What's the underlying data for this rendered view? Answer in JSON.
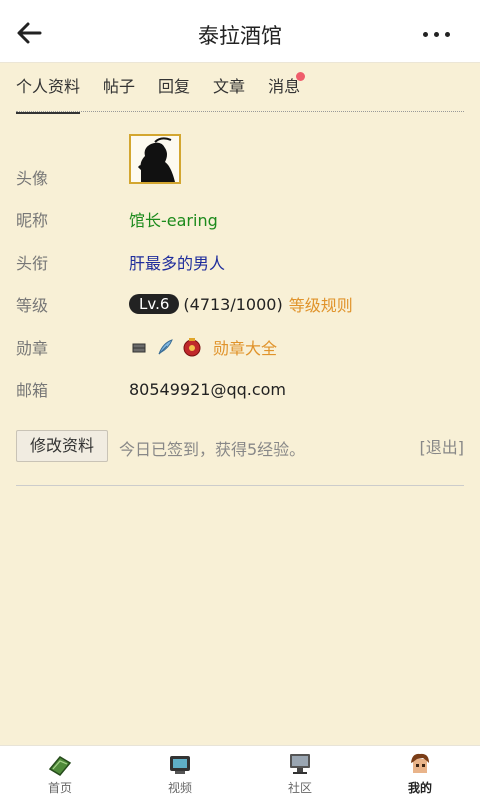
{
  "header": {
    "title": "泰拉酒馆"
  },
  "tabs": [
    {
      "label": "个人资料",
      "active": true
    },
    {
      "label": "帖子"
    },
    {
      "label": "回复"
    },
    {
      "label": "文章"
    },
    {
      "label": "消息",
      "has_dot": true
    }
  ],
  "profile": {
    "avatar_label": "头像",
    "nickname_label": "昵称",
    "nickname": "馆长-earing",
    "title_label": "头衔",
    "title": "肝最多的男人",
    "level_label": "等级",
    "level_badge": "Lv.6",
    "level_progress": "(4713/1000)",
    "level_rules": "等级规则",
    "medal_label": "勋章",
    "medal_link": "勋章大全",
    "email_label": "邮箱",
    "email": "80549921@qq.com"
  },
  "actions": {
    "edit_button": "修改资料",
    "signin_text": "今日已签到，获得5经验。",
    "logout": "[退出]"
  },
  "bottom_nav": [
    {
      "label": "首页",
      "icon": "home-book-icon"
    },
    {
      "label": "视频",
      "icon": "tv-icon"
    },
    {
      "label": "社区",
      "icon": "computer-icon"
    },
    {
      "label": "我的",
      "icon": "character-head-icon",
      "active": true
    }
  ],
  "colors": {
    "background": "#f8f0d6",
    "nickname": "#1c8a1c",
    "title": "#1f2d9c",
    "link": "#e0932b",
    "dot": "#ef5d6b"
  }
}
